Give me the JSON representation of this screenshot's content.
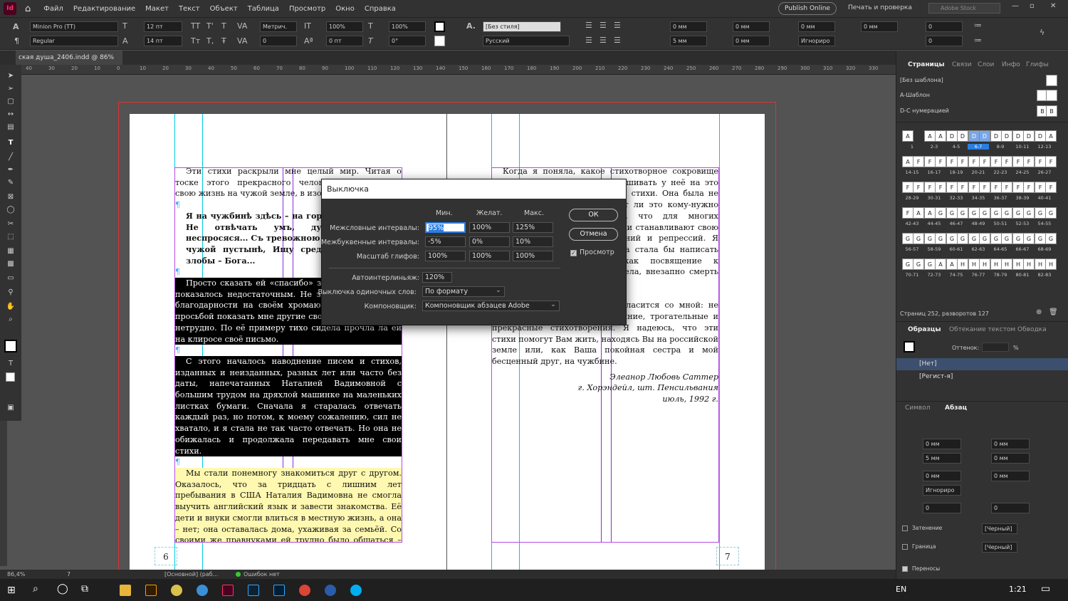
{
  "app": {
    "icon_label": "Id"
  },
  "menu": [
    "Файл",
    "Редактирование",
    "Макет",
    "Текст",
    "Объект",
    "Таблица",
    "Просмотр",
    "Окно",
    "Справка"
  ],
  "topright": {
    "publish_label": "Publish Online",
    "print_label": "Печать и проверка",
    "search_placeholder": "Adobe Stock"
  },
  "control_panel": {
    "font_family": "Minion Pro (TT)",
    "font_style": "Regular",
    "font_size": "12 пт",
    "leading": "14 пт",
    "kerning": "Метрич.",
    "tracking": "0",
    "vscale": "100%",
    "hscale": "100%",
    "baseline": "0 пт",
    "skew": "0°",
    "para_style": "[Без стиля]",
    "language": "Русский",
    "indent_left": "0 мм",
    "indent_right": "0 мм",
    "space_before": "0 мм",
    "space_after": "0 мм",
    "first_indent": "5 мм",
    "last_indent": "0 мм",
    "grid_align": "Игнориро",
    "drop_lines": "0",
    "drop_chars": "0"
  },
  "document_tab": "ская душа_2406.indd @ 86%",
  "ruler_ticks": [
    "40",
    "30",
    "20",
    "10",
    "0",
    "10",
    "20",
    "30",
    "40",
    "50",
    "60",
    "70",
    "80",
    "90",
    "100",
    "110",
    "120",
    "130",
    "140",
    "150",
    "160",
    "170",
    "180",
    "190",
    "200",
    "210",
    "220",
    "230",
    "240",
    "250",
    "260",
    "270",
    "280",
    "290",
    "300",
    "310",
    "320",
    "330"
  ],
  "left_page": {
    "paragraphs": [
      {
        "style": "normal",
        "text": "Эти стихи раскрыли мне целый мир. Читая о тоске этого прекрасного человека, прожившего свою жизнь на чужой земле, в изоляции, я была"
      },
      {
        "style": "bold",
        "text": "Я на чужбинѣ здѣсь – на горестной чужбинѣ, Не отвѣчать умъ, душа запросамъ неспросяся... Съ тревожною тоской брожу въ чужой пустынѣ, Ищу средь лжи, грѣха и злобы – Бога..."
      },
      {
        "style": "highlight",
        "text": "Просто сказать ей «спасибо» за такие стихи мне показалось недостаточным. Не зная, как выразить благодарности на своём хромающем русском, я с просьбой показать мне другие свои стихи. Это будет нетрудно. По её примеру тихо сидела прочла ла ей на клиросе своё письмо."
      },
      {
        "style": "highlight",
        "text": "С этого началось наводнение писем и стихов, изданных и неизданных, разных лет или часто без даты, напечатанных Наталией Вадимовной с большим трудом на дряхлой машинке на маленьких листках бумаги. Сначала я старалась отвечать каждый раз, но потом, к моему сожалению, сил не хватало, и я стала не так часто отвечать. Но она не обижалась и продолжала передавать мне свои стихи."
      },
      {
        "style": "yellow",
        "text": "Мы стали понемногу знакомиться друг с другом. Оказалось, что за тридцать с лишним лет пребывания в США Наталия Вадимовна не смогла выучить английский язык и завести знакомства. Её дети и внуки смогли влиться в местную жизнь, а она – нет; она оставалась дома, ухаживая за семьёй. Со своими же правнуками ей трудно было общаться – они мало знали русский язык."
      }
    ],
    "page_number": "6"
  },
  "right_page": {
    "paragraphs": [
      {
        "text": "Когда я поняла, какое стихотворное сокровище имеется у меня, я стала спрашивать у неё на это разрешение вновь издать свои стихи. Она была не против, но сомневалась, будет ли это кому-нужно или интересно. Я уверена, что для многих читателей российских эти стихи станавливают свою духовную ценность переживаний и репрессий. Я попросила Наталия Вадимовна стала бы написать последнее стихотворение, как посвящение к изданию. Но, увы, она не успела, внезапно смерть застала её зимой"
      },
      {
        "text": "Мне кажется, читатель согласится со мной: не должны погибнуть эти искренние, трогательные и прекрасные стихотворения. Я надеюсь, что эти стихи помогут Вам жить, находясь Вы на российской земле или, как Ваша покойная сестра и мой бесценный друг, на чужбине."
      }
    ],
    "signature": [
      "Элеанор Любовь Саттер",
      "г. Хорэндейл, шт. Пенсильвания",
      "июль, 1992 г."
    ],
    "page_number": "7"
  },
  "dialog": {
    "title": "Выключка",
    "col_min": "Мин.",
    "col_desired": "Желат.",
    "col_max": "Макс.",
    "rows": [
      {
        "label": "Межсловные интервалы:",
        "min": "95%",
        "desired": "100%",
        "max": "125%"
      },
      {
        "label": "Межбуквенные интервалы:",
        "min": "-5%",
        "desired": "0%",
        "max": "10%"
      },
      {
        "label": "Масштаб глифов:",
        "min": "100%",
        "desired": "100%",
        "max": "100%"
      }
    ],
    "auto_leading_label": "Автоинтерлиньяж:",
    "auto_leading_value": "120%",
    "single_word_label": "Выключка одиночных слов:",
    "single_word_value": "По формату",
    "composer_label": "Компоновщик:",
    "composer_value": "Компоновщик абзацев Adobe",
    "ok_label": "ОК",
    "cancel_label": "Отмена",
    "preview_label": "Просмотр"
  },
  "pages_panel": {
    "tabs": [
      "Страницы",
      "Связи",
      "Слои",
      "Инфо",
      "Глифы"
    ],
    "masters": [
      "[Без шаблона]",
      "А-Шаблон",
      "D-C нумерацией"
    ],
    "spreads": [
      [
        "1",
        "2-3",
        "4-5",
        "6-7",
        "8-9",
        "10-11",
        "12-13"
      ],
      [
        "14-15",
        "16-17",
        "18-19",
        "20-21",
        "22-23",
        "24-25",
        "26-27"
      ],
      [
        "28-29",
        "30-31",
        "32-33",
        "34-35",
        "36-37",
        "38-39",
        "40-41"
      ],
      [
        "42-43",
        "44-45",
        "46-47",
        "48-49",
        "50-51",
        "52-53",
        "54-55"
      ],
      [
        "56-57",
        "58-59",
        "60-61",
        "62-63",
        "64-65",
        "66-67",
        "68-69"
      ],
      [
        "70-71",
        "72-73",
        "74-75",
        "76-77",
        "78-79",
        "80-81",
        "82-83"
      ]
    ],
    "summary": "Страниц 252, разворотов 127"
  },
  "swatches_panel": {
    "tabs": [
      "Образцы",
      "Обтекание текстом",
      "Обводка"
    ],
    "tint_label": "Оттенок:",
    "tint_unit": "%",
    "items": [
      "[Нет]",
      "[Регист-я]"
    ]
  },
  "paragraph_panel": {
    "tabs": [
      "Символ",
      "Абзац"
    ],
    "left_indent": "0 мм",
    "right_indent": "0 мм",
    "first_line": "5 мм",
    "last_line": "0 мм",
    "space_before": "0 мм",
    "space_after": "0 мм",
    "grid": "Игнориро",
    "drop_lines": "0",
    "drop_chars": "0",
    "shading_label": "Затенение",
    "border_label": "Граница",
    "shading_color": "[Черный]",
    "border_color": "[Черный]",
    "hyphen_label": "Переносы"
  },
  "status": {
    "zoom": "86,4%",
    "page": "7",
    "style": "[Основной] (раб...",
    "errors": "Ошибок нет"
  },
  "taskbar": {
    "lang": "EN",
    "time": "1:21"
  }
}
